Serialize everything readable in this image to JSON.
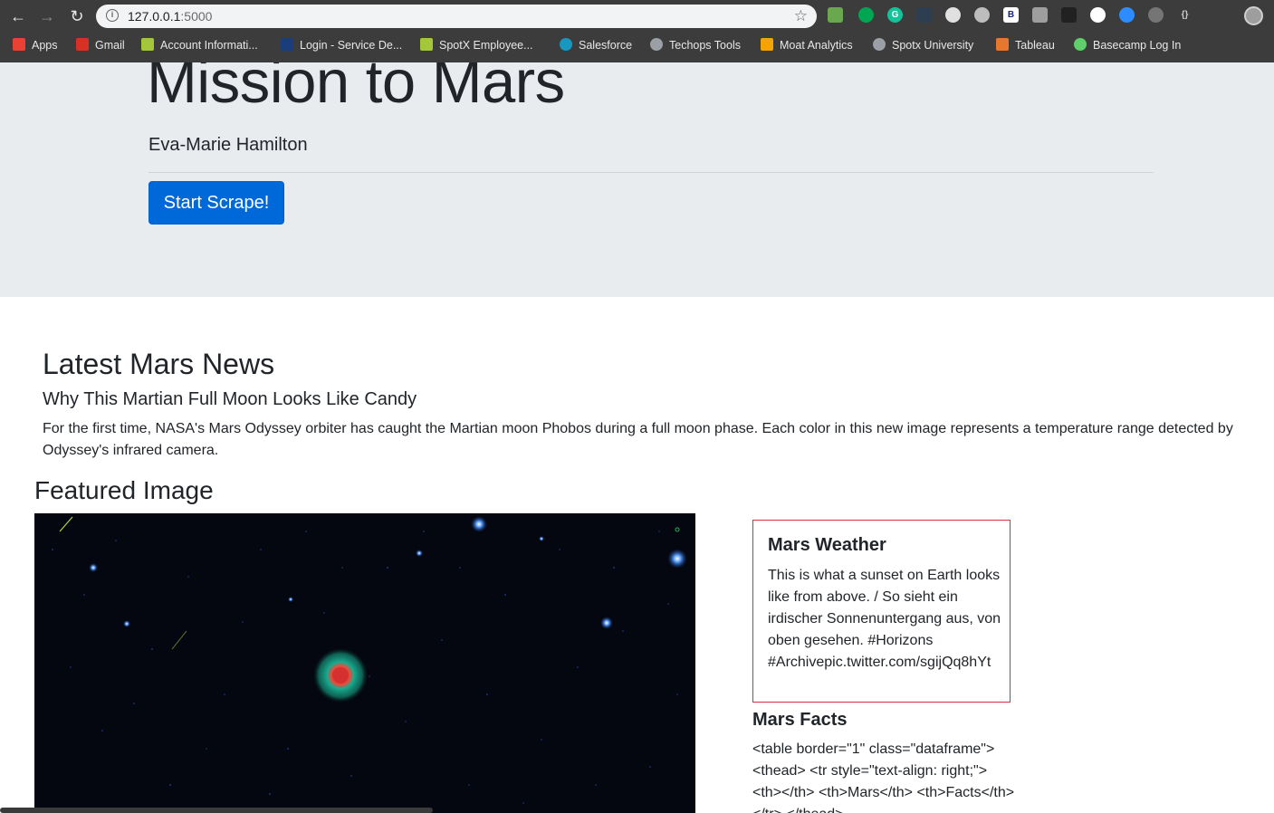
{
  "browser": {
    "url_host": "127.0.0.1",
    "url_port": ":5000"
  },
  "bookmarks": [
    {
      "label": "Apps",
      "color": "#e94235"
    },
    {
      "label": "Gmail",
      "color": "#d93025"
    },
    {
      "label": "Account Informati...",
      "color": "#a4c639"
    },
    {
      "label": "Login - Service De...",
      "color": "#1a3d7c"
    },
    {
      "label": "SpotX Employee...",
      "color": "#a4c639"
    },
    {
      "label": "Salesforce",
      "color": "#1798c1"
    },
    {
      "label": "Techops Tools",
      "color": "#9aa0a6"
    },
    {
      "label": "Moat Analytics",
      "color": "#f4a300"
    },
    {
      "label": "Spotx University",
      "color": "#9aa0a6"
    },
    {
      "label": "Tableau",
      "color": "#e8762d"
    },
    {
      "label": "Basecamp Log In",
      "color": "#5ecf6b"
    }
  ],
  "jumbotron": {
    "title": "Mission to Mars",
    "subtitle": "Eva-Marie Hamilton",
    "button_label": "Start Scrape!"
  },
  "news": {
    "section_title": "Latest Mars News",
    "headline": "Why This Martian Full Moon Looks Like Candy",
    "body": "For the first time, NASA's Mars Odyssey orbiter has caught the Martian moon Phobos during a full moon phase. Each color in this new image represents a temperature range detected by Odyssey's infrared camera."
  },
  "featured": {
    "section_title": "Featured Image"
  },
  "weather": {
    "title": "Mars Weather",
    "text": "This is what a sunset on Earth looks like from above. / So sieht ein irdischer Sonnenuntergang aus, von oben gesehen. #Horizons #Archivepic.twitter.com/sgijQq8hYt"
  },
  "facts": {
    "title": "Mars Facts",
    "raw_html": "<table border=\"1\" class=\"dataframe\"> <thead> <tr style=\"text-align: right;\"> <th></th> <th>Mars</th> <th>Facts</th> </tr> </thead>"
  },
  "colors": {
    "jumbotron_bg": "#e9ecef",
    "primary": "#0069d9",
    "weather_border": "#d32f3f",
    "chrome": "#3c3c3c"
  }
}
